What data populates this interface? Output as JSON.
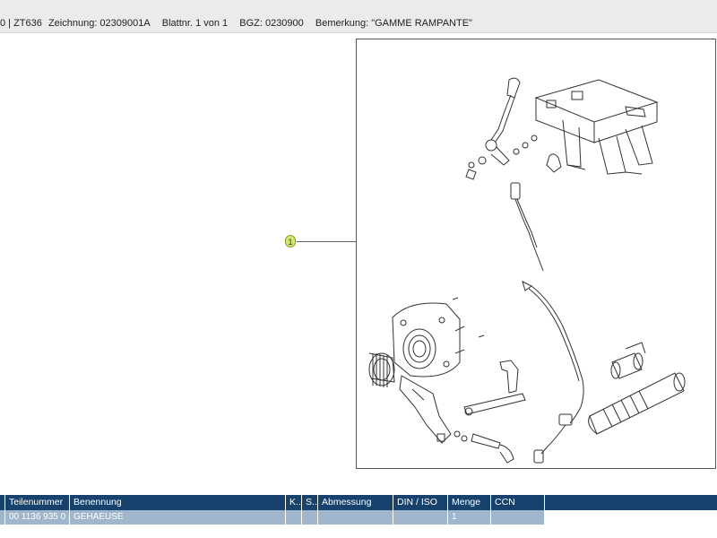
{
  "header": {
    "prefix": "0 | ZT636",
    "zeichnung": "Zeichnung: 02309001A",
    "blatt": "Blattnr. 1 von 1",
    "bgz": "BGZ: 0230900",
    "bemerkung": "Bemerkung: \"GAMME RAMPANTE\""
  },
  "drawing": {
    "callout_number": "1",
    "marker_color": "#cfe86a"
  },
  "table": {
    "columns": [
      "Teilenummer",
      "Benennung",
      "K..",
      "S..",
      "Abmessung",
      "DIN / ISO",
      "Menge",
      "CCN"
    ],
    "rows": [
      {
        "teilenummer": "00 1136 935 0",
        "benennung": "GEHAEUSE",
        "k": "",
        "s": "",
        "abmessung": "",
        "din_iso": "",
        "menge": "1",
        "ccn": ""
      }
    ],
    "header_color": "#16426d",
    "selected_row_color": "#9fb6cd"
  }
}
